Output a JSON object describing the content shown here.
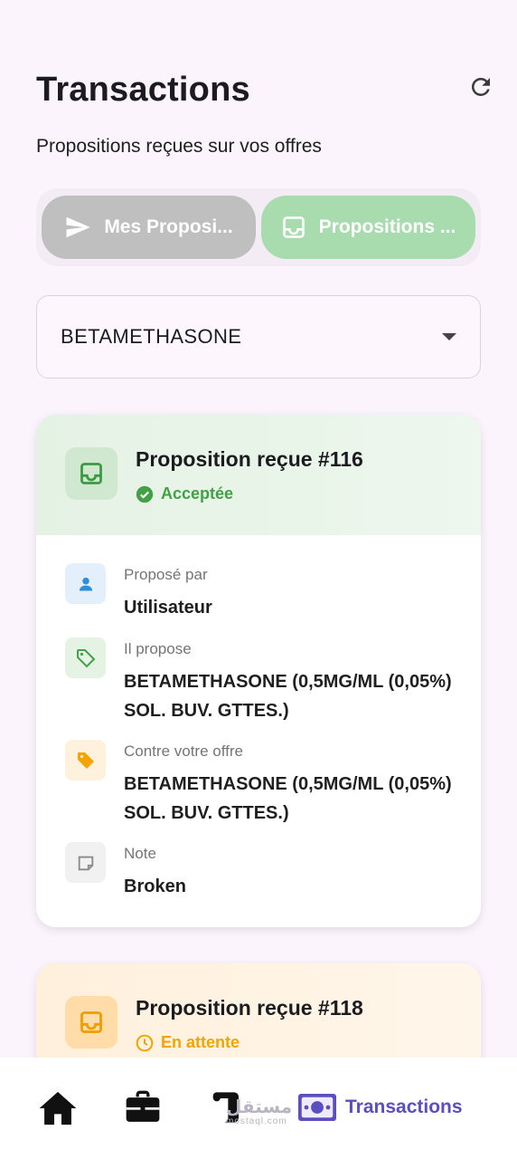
{
  "header": {
    "title": "Transactions",
    "subtitle": "Propositions reçues sur vos offres"
  },
  "segmented": {
    "sent_label": "Mes Proposi...",
    "received_label": "Propositions ..."
  },
  "filter": {
    "selected": "BETAMETHASONE"
  },
  "cards": [
    {
      "title": "Proposition reçue #116",
      "status": "Acceptée",
      "status_color": "#43a047",
      "rows": {
        "proposed_by_label": "Proposé par",
        "proposed_by_value": "Utilisateur",
        "offers_label": "Il propose",
        "offers_value": "BETAMETHASONE (0,5MG/ML (0,05%) SOL. BUV. GTTES.)",
        "against_label": "Contre votre offre",
        "against_value": "BETAMETHASONE (0,5MG/ML (0,05%) SOL. BUV. GTTES.)",
        "note_label": "Note",
        "note_value": "Broken"
      }
    },
    {
      "title": "Proposition reçue #118",
      "status": "En attente",
      "status_color": "#f0a500"
    }
  ],
  "bottom_nav": {
    "active_label": "Transactions",
    "accent": "#5b4fbf"
  },
  "watermark": {
    "main": "مستقل",
    "sub": "mostaql.com"
  }
}
